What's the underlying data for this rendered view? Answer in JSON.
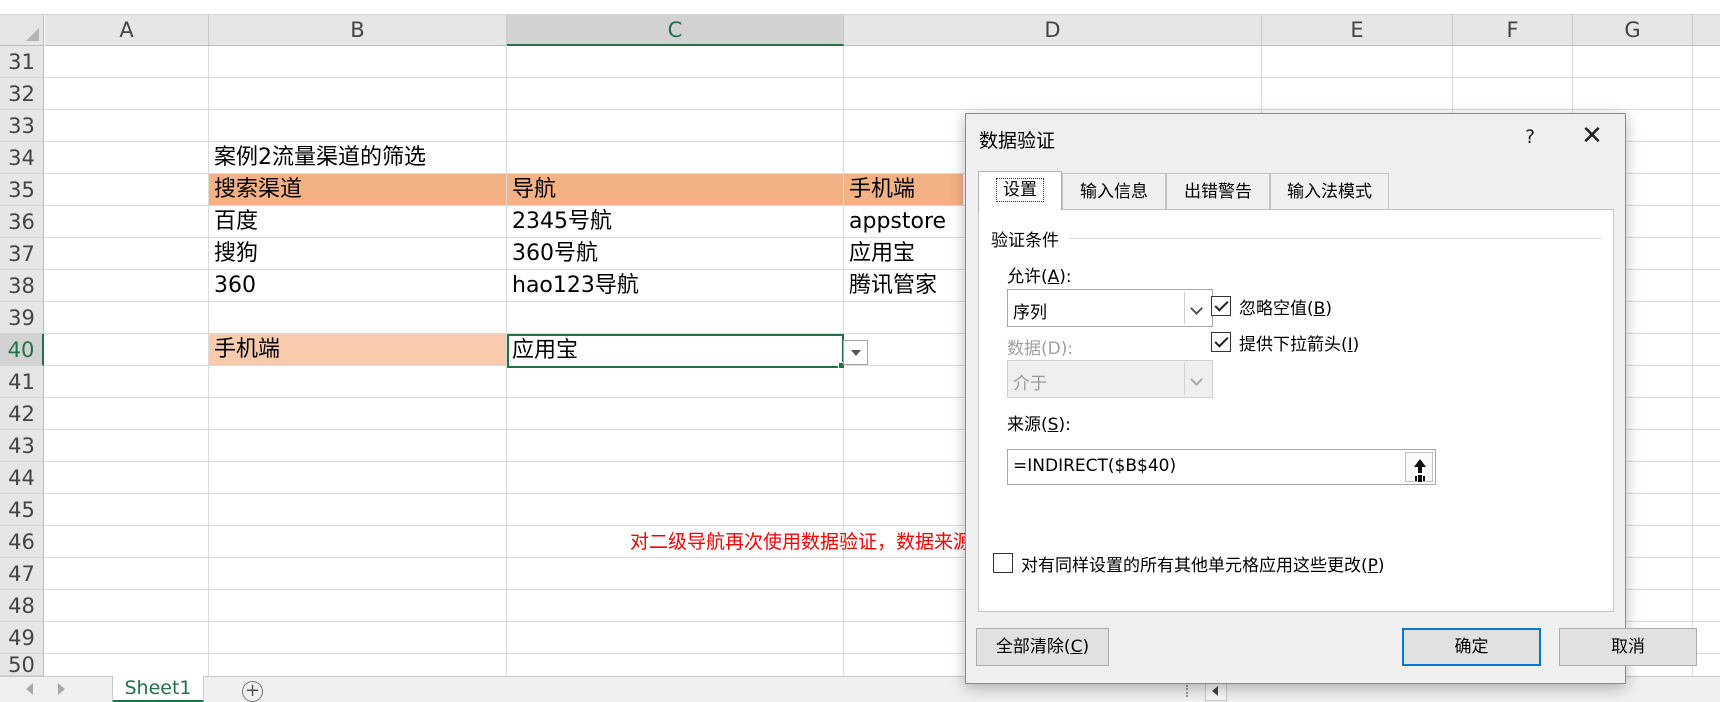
{
  "sheet": {
    "columns": [
      "A",
      "B",
      "C",
      "D",
      "E",
      "F",
      "G"
    ],
    "selected_column": "C",
    "rows": [
      "31",
      "32",
      "33",
      "34",
      "35",
      "36",
      "37",
      "38",
      "39",
      "40",
      "41",
      "42",
      "43",
      "44",
      "45",
      "46",
      "47",
      "48",
      "49",
      "50"
    ],
    "selected_row": "40",
    "cells": {
      "b34": "案例2流量渠道的筛选",
      "b35": "搜索渠道",
      "c35": "导航",
      "d35": "手机端",
      "b36": "百度",
      "c36": "2345号航",
      "d36": "appstore",
      "b37": "搜狗",
      "c37": "360号航",
      "d37": "应用宝",
      "b38": "360",
      "c38": "hao123导航",
      "d38": "腾讯管家",
      "b40": "手机端",
      "c40": "应用宝"
    },
    "header_band_color": "#f4b183",
    "row40_band_color": "#f8cbad",
    "annotation": "对二级导航再次使用数据验证，数据来源为，一级导航中文本所指的区域，用indirect返回",
    "annotation_color": "#ff0000"
  },
  "tabs_bar": {
    "sheet_tab": "Sheet1",
    "add_sheet_icon": "plus-circle-icon"
  },
  "dialog": {
    "title": "数据验证",
    "help": "?",
    "close": "✕",
    "tabs": [
      "设置",
      "输入信息",
      "出错警告",
      "输入法模式"
    ],
    "active_tab": "设置",
    "group_title": "验证条件",
    "allow_label": "允许(",
    "allow_key": "A",
    "allow_label_end": "):",
    "allow_value": "序列",
    "data_label": "数据(D):",
    "data_value": "介于",
    "ignore_blank_label": "忽略空值(",
    "ignore_blank_key": "B",
    "ignore_blank_end": ")",
    "ignore_blank_checked": true,
    "dropdown_label": "提供下拉箭头(",
    "dropdown_key": "I",
    "dropdown_end": ")",
    "dropdown_checked": true,
    "source_label": "来源(",
    "source_key": "S",
    "source_label_end": "):",
    "source_value": "=INDIRECT($B$40)",
    "apply_all_label": "对有同样设置的所有其他单元格应用这些更改(",
    "apply_all_key": "P",
    "apply_all_end": ")",
    "apply_all_checked": false,
    "clear_all_button": "全部清除(",
    "clear_all_key": "C",
    "clear_all_end": ")",
    "ok_button": "确定",
    "cancel_button": "取消",
    "accent_color": "#0078d7"
  }
}
